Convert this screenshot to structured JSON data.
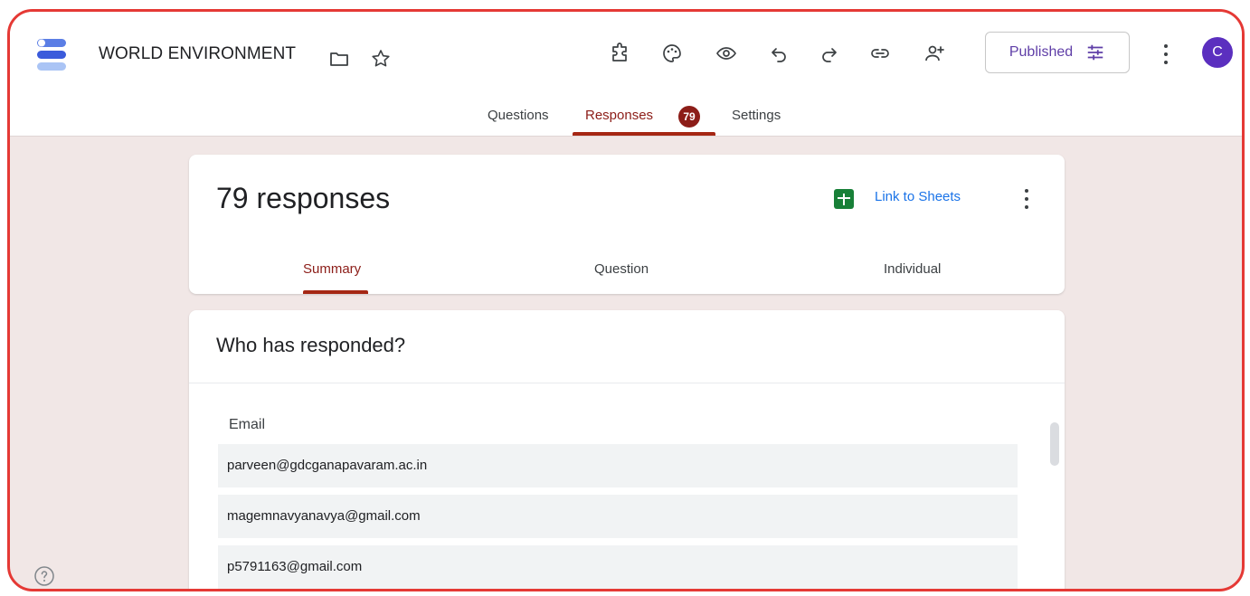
{
  "header": {
    "title": "WORLD ENVIRONMENT",
    "publish_label": "Published",
    "avatar_letter": "C",
    "icons": [
      "addon-icon",
      "palette-icon",
      "preview-icon",
      "undo-icon",
      "redo-icon",
      "link-icon",
      "add-collaborator-icon",
      "publish-settings-icon",
      "more-vert-icon"
    ]
  },
  "tabs": {
    "questions": "Questions",
    "responses": "Responses",
    "responses_count": "79",
    "settings": "Settings"
  },
  "summary_card": {
    "title": "79 responses",
    "link_to_sheets": "Link to Sheets",
    "subtabs": {
      "summary": "Summary",
      "question": "Question",
      "individual": "Individual"
    }
  },
  "responders": {
    "heading": "Who has responded?",
    "column": "Email",
    "emails": [
      "parveen@gdcganapavaram.ac.in",
      "magemnavyanavya@gmail.com",
      "p5791163@gmail.com"
    ]
  },
  "colors": {
    "accent": "#8c1d18",
    "page_bg": "#f1e7e6",
    "link": "#1a73e8",
    "avatar": "#5b2fbf",
    "frame_border": "#e53935"
  }
}
